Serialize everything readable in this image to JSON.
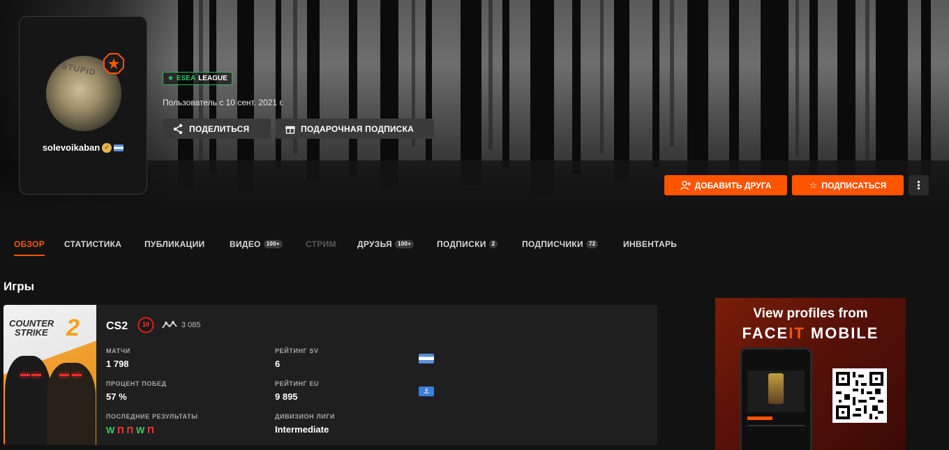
{
  "profile": {
    "username": "solevoikaban",
    "avatar_text": "STUPID",
    "badge_label": "ESEA",
    "badge_league": "LEAGUE",
    "member_since": "Пользователь с 10 сент. 2021 г.",
    "share_label": "ПОДЕЛИТЬСЯ",
    "gift_label": "ПОДАРОЧНАЯ ПОДПИСКА",
    "add_friend_label": "ДОБАВИТЬ ДРУГА",
    "subscribe_label": "ПОДПИСАТЬСЯ",
    "more_label": "⋮"
  },
  "tabs": [
    {
      "label": "ОБЗОР"
    },
    {
      "label": "СТАТИСТИКА"
    },
    {
      "label": "ПУБЛИКАЦИИ"
    },
    {
      "label": "ВИДЕО",
      "count": "100+"
    },
    {
      "label": "СТРИМ"
    },
    {
      "label": "ДРУЗЬЯ",
      "count": "100+"
    },
    {
      "label": "ПОДПИСКИ",
      "count": "2"
    },
    {
      "label": "ПОДПИСЧИКИ",
      "count": "72"
    },
    {
      "label": "ИНВЕНТАРЬ"
    }
  ],
  "games_title": "Игры",
  "game": {
    "cover_title_1": "COUNTER",
    "cover_title_2": "STRIKE",
    "cover_number": "2",
    "name": "CS2",
    "level": "10",
    "elo": "3 085",
    "matches_label": "МАТЧИ",
    "matches_value": "1 798",
    "winrate_label": "ПРОЦЕНТ ПОБЕД",
    "winrate_value": "57 %",
    "recent_label": "ПОСЛЕДНИЕ РЕЗУЛЬТАТЫ",
    "recent_results": [
      "W",
      "П",
      "П",
      "W",
      "П"
    ],
    "rating_sv_label": "РЕЙТИНГ SV",
    "rating_sv_value": "6",
    "rating_eu_label": "РЕЙТИНГ EU",
    "rating_eu_value": "9 895",
    "division_label": "ДИВИЗИОН ЛИГИ",
    "division_value": "Intermediate"
  },
  "ad": {
    "line1": "View profiles from",
    "line2_a": "FACE",
    "line2_b": "IT",
    "line2_c": " MOBILE"
  },
  "colors": {
    "accent": "#ff5500",
    "win": "#32d35a",
    "loss": "#ff3b3b",
    "esea": "#2fd06a"
  }
}
